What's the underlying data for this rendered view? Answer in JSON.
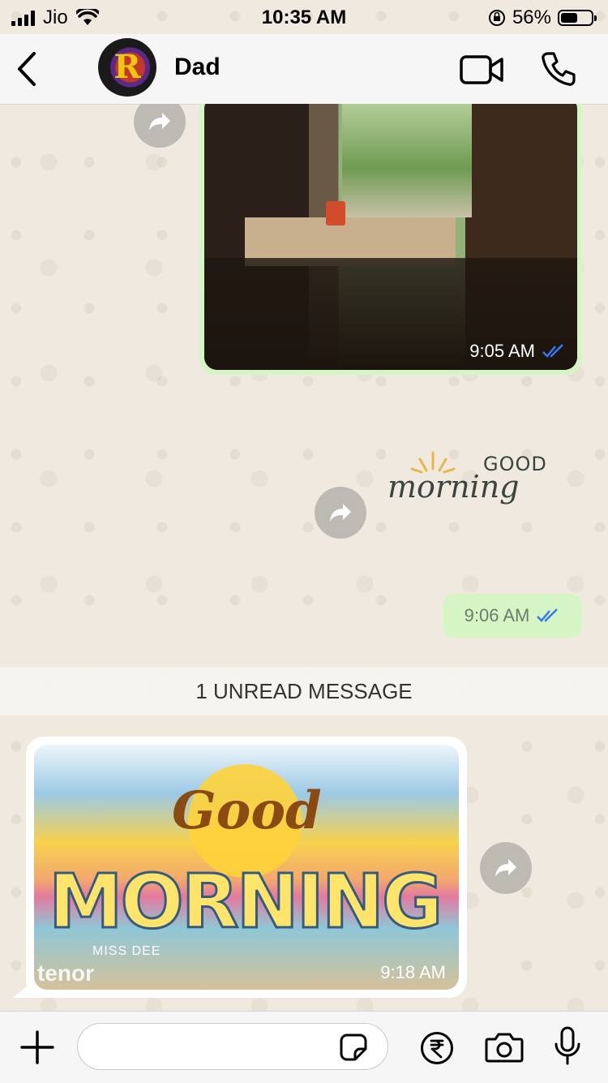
{
  "status_bar": {
    "carrier": "Jio",
    "time": "10:35 AM",
    "battery_percent": "56%"
  },
  "header": {
    "contact_name": "Dad",
    "avatar_letter": "R"
  },
  "messages": {
    "photo_time": "9:05 AM",
    "sticker_good": "GOOD",
    "sticker_morning": "morning",
    "sticker_time": "9:06 AM",
    "unread_banner": "1 UNREAD MESSAGE",
    "gif_text_good": "Good",
    "gif_text_morning": "MORNING",
    "gif_text_credit": "MISS DEE",
    "gif_source": "tenor",
    "gif_time": "9:18 AM"
  },
  "colors": {
    "outgoing_bubble": "#d6f5c5",
    "incoming_bubble": "#ffffff",
    "read_ticks": "#3478f6"
  },
  "icons": [
    "back-chevron-icon",
    "video-call-icon",
    "voice-call-icon",
    "forward-icon",
    "plus-icon",
    "sticker-icon",
    "rupee-payment-icon",
    "camera-icon",
    "microphone-icon"
  ]
}
